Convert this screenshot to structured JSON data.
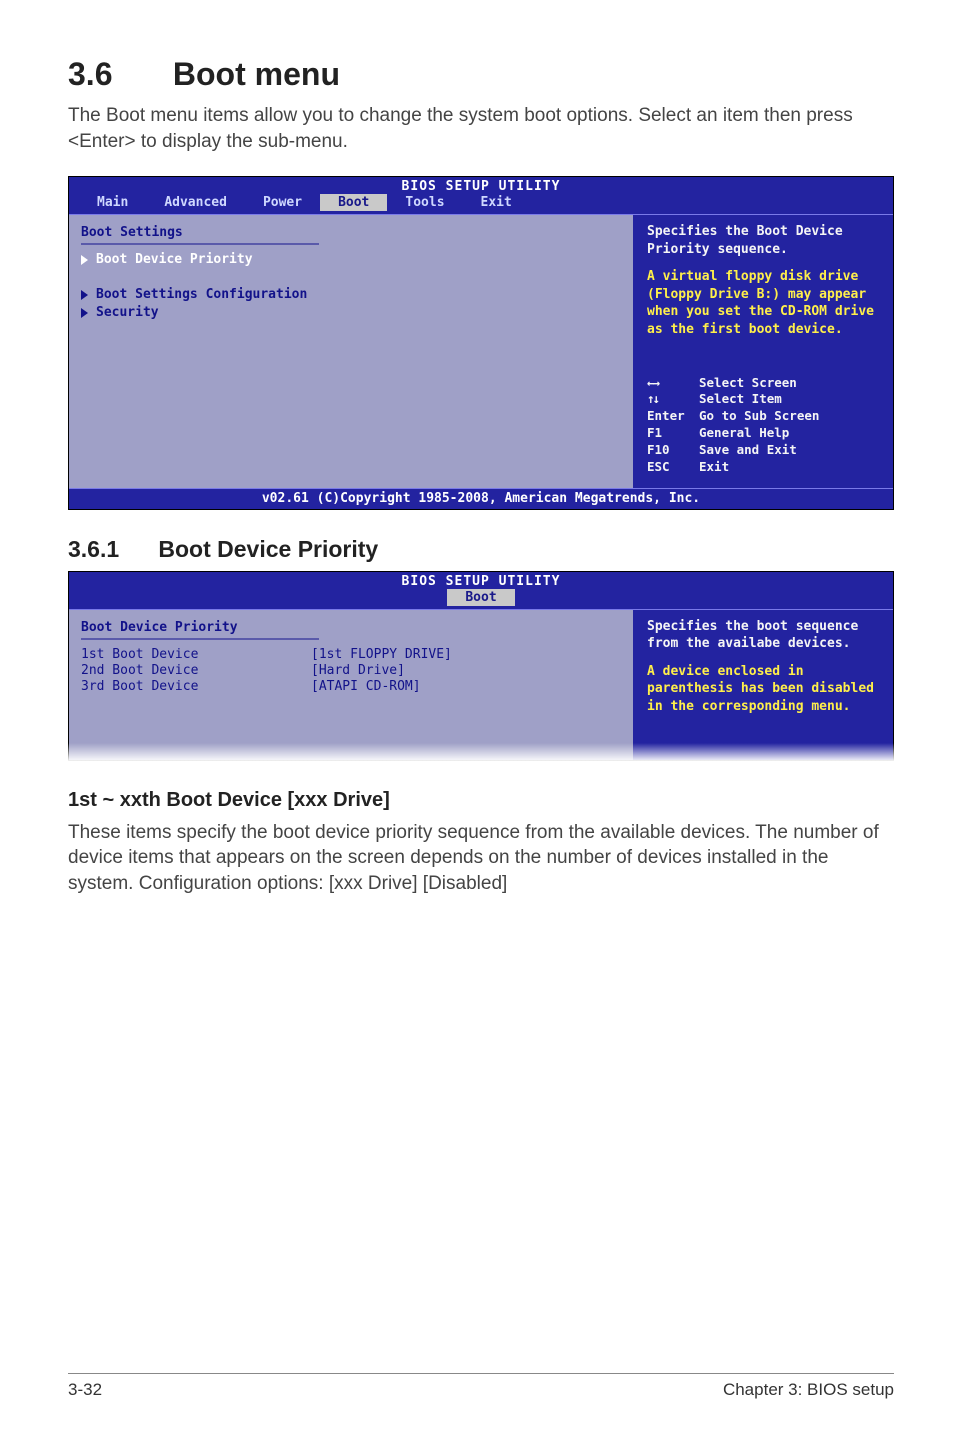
{
  "section": {
    "number": "3.6",
    "title": "Boot menu",
    "intro": "The Boot menu items allow you to change the system boot options. Select an item then press <Enter> to display the sub-menu."
  },
  "bios1": {
    "title": "BIOS SETUP UTILITY",
    "tabs": [
      "Main",
      "Advanced",
      "Power",
      "Boot",
      "Tools",
      "Exit"
    ],
    "active_tab": "Boot",
    "panel_title": "Boot Settings",
    "items": [
      {
        "label": "Boot Device Priority",
        "selected": true
      },
      {
        "label": "Boot Settings Configuration",
        "selected": false
      },
      {
        "label": "Security",
        "selected": false
      }
    ],
    "help_primary": "Specifies the Boot Device Priority sequence.",
    "help_secondary": "A virtual floppy disk drive (Floppy Drive B:) may appear when you set the CD-ROM drive as the first boot device.",
    "keys": [
      {
        "k": "↔",
        "d": "Select Screen"
      },
      {
        "k": "↕",
        "d": "Select Item"
      },
      {
        "k": "Enter",
        "d": "Go to Sub Screen"
      },
      {
        "k": "F1",
        "d": "General Help"
      },
      {
        "k": "F10",
        "d": "Save and Exit"
      },
      {
        "k": "ESC",
        "d": "Exit"
      }
    ],
    "footer": "v02.61 (C)Copyright 1985-2008, American Megatrends, Inc."
  },
  "subsection": {
    "number": "3.6.1",
    "title": "Boot Device Priority"
  },
  "bios2": {
    "title": "BIOS SETUP UTILITY",
    "active_tab": "Boot",
    "panel_title": "Boot Device Priority",
    "devices": [
      {
        "label": "1st Boot Device",
        "value": "[1st FLOPPY DRIVE]"
      },
      {
        "label": "2nd Boot Device",
        "value": "[Hard Drive]"
      },
      {
        "label": "3rd Boot Device",
        "value": "[ATAPI CD-ROM]"
      }
    ],
    "help_primary": "Specifies the boot sequence from the availabe devices.",
    "help_secondary": "A device enclosed in parenthesis has been disabled in the corresponding menu."
  },
  "paragraph": {
    "heading": "1st ~ xxth Boot Device [xxx Drive]",
    "body": "These items specify the boot device priority sequence from the available devices. The number of device items that appears on the screen depends on the number of devices installed in the system. Configuration options: [xxx Drive] [Disabled]"
  },
  "footer": {
    "left": "3-32",
    "right": "Chapter 3: BIOS setup"
  }
}
